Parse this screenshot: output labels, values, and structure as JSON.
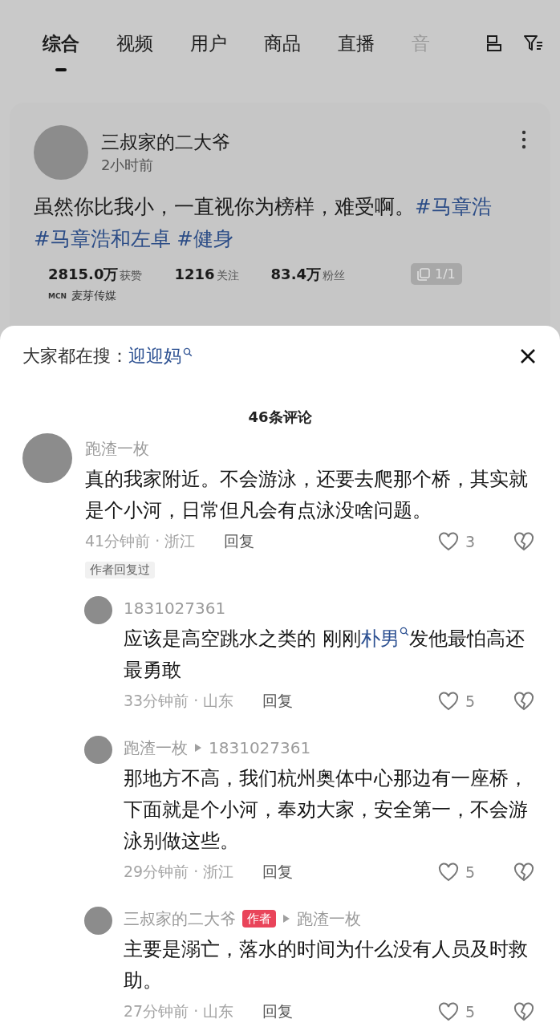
{
  "tabs": [
    {
      "label": "综合",
      "selected": true
    },
    {
      "label": "视频",
      "selected": false
    },
    {
      "label": "用户",
      "selected": false
    },
    {
      "label": "商品",
      "selected": false
    },
    {
      "label": "直播",
      "selected": false
    },
    {
      "label": "音",
      "selected": false
    }
  ],
  "post": {
    "author": "三叔家的二大爷",
    "time": "2小时前",
    "text_parts": [
      {
        "kind": "plain",
        "text": "虽然你比我小，一直视你为榜样，难受啊。"
      },
      {
        "kind": "hashtag",
        "text": "#马章浩"
      },
      {
        "kind": "hashtag",
        "text": "#马章浩和左卓"
      },
      {
        "kind": "hashtag",
        "text": "#健身"
      }
    ],
    "stats": [
      {
        "value": "2815.0万",
        "label": "获赞"
      },
      {
        "value": "1216",
        "label": "关注"
      },
      {
        "value": "83.4万",
        "label": "粉丝"
      }
    ],
    "image_counter": "1/1",
    "mcn": "MCN",
    "agency": "麦芽传媒"
  },
  "sheet": {
    "trending_label": "大家都在搜：",
    "trending_term": "迎迎妈",
    "count": "46条评论",
    "comments": [
      {
        "user": "跑渣一枚",
        "text_parts": [
          {
            "kind": "plain",
            "text": "真的我家附近。不会游泳，还要去爬那个桥，其实就是个小河，日常但凡会有点泳没啥问题。"
          }
        ],
        "meta": "41分钟前 · 浙江",
        "reply": "回复",
        "likes": "3",
        "author_replied": "作者回复过",
        "children": [
          {
            "user": "1831027361",
            "text_parts": [
              {
                "kind": "plain",
                "text": "应该是高空跳水之类的 刚刚"
              },
              {
                "kind": "search",
                "text": "朴男"
              },
              {
                "kind": "plain",
                "text": "发他最怕高还最勇敢"
              }
            ],
            "meta": "33分钟前 · 山东",
            "reply": "回复",
            "likes": "5"
          },
          {
            "user": "跑渣一枚",
            "reply_to": "1831027361",
            "text_parts": [
              {
                "kind": "plain",
                "text": "那地方不高，我们杭州奥体中心那边有一座桥，下面就是个小河，奉劝大家，安全第一，不会游泳别做这些。"
              }
            ],
            "meta": "29分钟前 · 浙江",
            "reply": "回复",
            "likes": "5"
          },
          {
            "user": "三叔家的二大爷",
            "author_badge": "作者",
            "reply_to": "跑渣一枚",
            "text_parts": [
              {
                "kind": "plain",
                "text": "主要是溺亡，落水的时间为什么没有人员及时救助。"
              }
            ],
            "meta": "27分钟前 · 山东",
            "reply": "回复",
            "likes": "5"
          }
        ]
      }
    ]
  }
}
